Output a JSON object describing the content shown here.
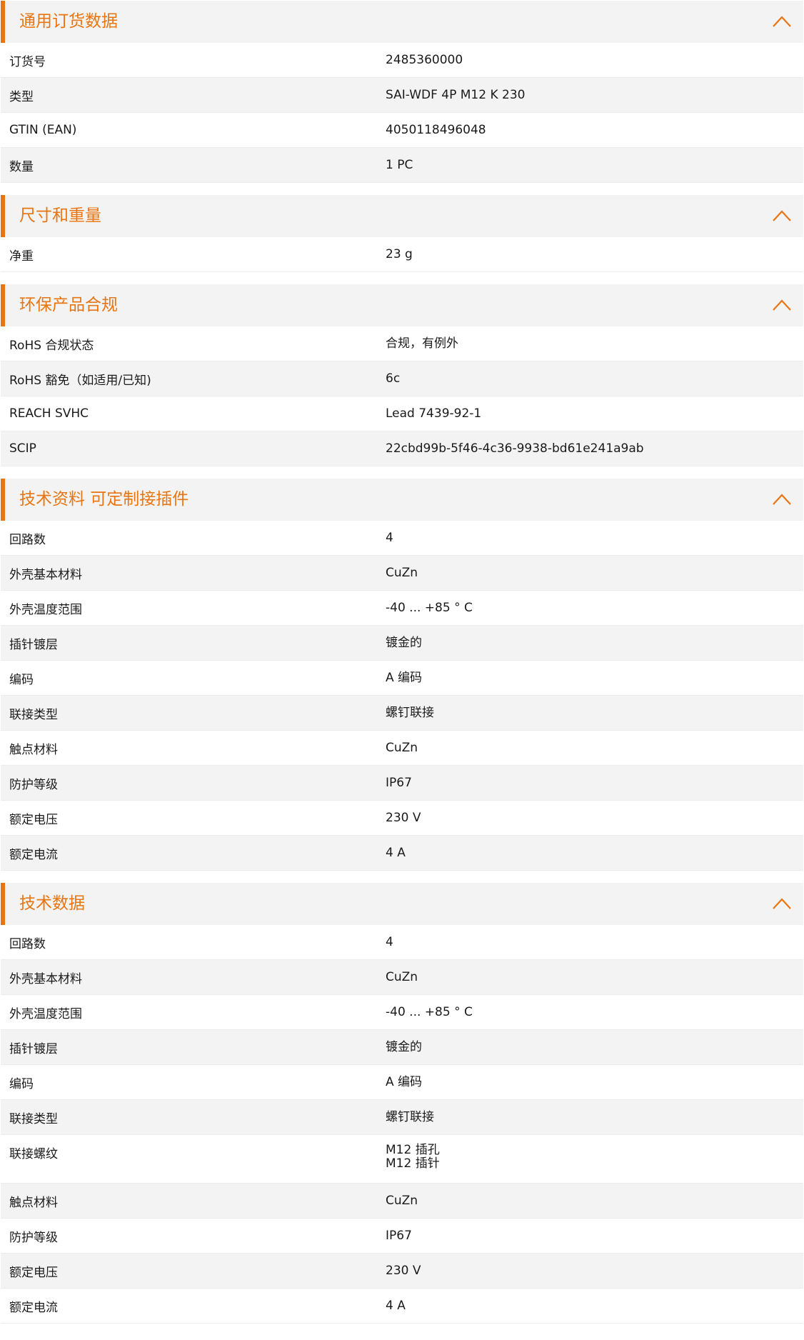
{
  "accent_color": "#e87511",
  "toggle_icon": "chevron-up-icon",
  "sections": [
    {
      "title": "通用订货数据",
      "rows": [
        {
          "label": "订货号",
          "value": "2485360000"
        },
        {
          "label": "类型",
          "value": "SAI-WDF 4P M12 K 230"
        },
        {
          "label": "GTIN (EAN)",
          "value": "4050118496048"
        },
        {
          "label": "数量",
          "value": "1  PC"
        }
      ]
    },
    {
      "title": "尺寸和重量",
      "rows": [
        {
          "label": "净重",
          "value": "23  g"
        }
      ]
    },
    {
      "title": "环保产品合规",
      "rows": [
        {
          "label": "RoHS 合规状态",
          "value": "合规，有例外"
        },
        {
          "label": "RoHS 豁免（如适用/已知)",
          "value": "6c"
        },
        {
          "label": "REACH SVHC",
          "value": "Lead 7439-92-1"
        },
        {
          "label": "SCIP",
          "value": "22cbd99b-5f46-4c36-9938-bd61e241a9ab"
        }
      ]
    },
    {
      "title": "技术资料 可定制接插件",
      "rows": [
        {
          "label": "回路数",
          "value": "4"
        },
        {
          "label": "外壳基本材料",
          "value": "CuZn"
        },
        {
          "label": "外壳温度范围",
          "value": "-40 ... +85 ° C"
        },
        {
          "label": "插针镀层",
          "value": "镀金的"
        },
        {
          "label": "编码",
          "value": "A 编码"
        },
        {
          "label": "联接类型",
          "value": "螺钉联接"
        },
        {
          "label": "触点材料",
          "value": "CuZn"
        },
        {
          "label": "防护等级",
          "value": "IP67"
        },
        {
          "label": "额定电压",
          "value": "230  V"
        },
        {
          "label": "额定电流",
          "value": "4  A"
        }
      ]
    },
    {
      "title": "技术数据",
      "rows": [
        {
          "label": "回路数",
          "value": "4"
        },
        {
          "label": "外壳基本材料",
          "value": "CuZn"
        },
        {
          "label": "外壳温度范围",
          "value": "-40 ... +85 ° C"
        },
        {
          "label": "插针镀层",
          "value": "镀金的"
        },
        {
          "label": "编码",
          "value": "A 编码"
        },
        {
          "label": "联接类型",
          "value": "螺钉联接"
        },
        {
          "label": "联接螺纹",
          "value": "M12 插孔\nM12 插针"
        },
        {
          "label": "触点材料",
          "value": "CuZn"
        },
        {
          "label": "防护等级",
          "value": "IP67"
        },
        {
          "label": "额定电压",
          "value": "230  V"
        },
        {
          "label": "额定电流",
          "value": "4  A"
        }
      ]
    }
  ]
}
